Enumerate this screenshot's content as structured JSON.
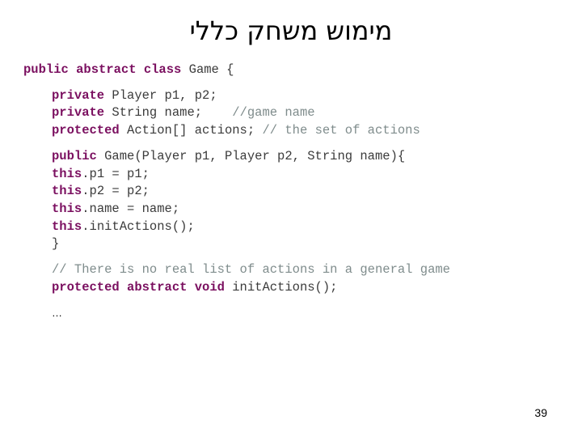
{
  "slide": {
    "title": "מימוש משחק כללי",
    "page_number": "39",
    "accent_keyword_color": "#7B1060",
    "comment_color": "#7F8C8C",
    "code_color": "#3B3B3B",
    "background_color": "#FFFFFF"
  },
  "code": {
    "language": "java",
    "lines": [
      {
        "indent": 0,
        "tokens": [
          {
            "type": "keyword",
            "text": "public abstract class"
          },
          {
            "type": "plain",
            "text": " Game {"
          }
        ]
      },
      {
        "indent": 0,
        "spacer": true,
        "tokens": []
      },
      {
        "indent": 1,
        "tokens": [
          {
            "type": "keyword",
            "text": "private"
          },
          {
            "type": "plain",
            "text": " Player p1, p2;"
          }
        ]
      },
      {
        "indent": 1,
        "tokens": [
          {
            "type": "keyword",
            "text": "private"
          },
          {
            "type": "plain",
            "text": " String name;    "
          },
          {
            "type": "comment",
            "text": "//game name"
          }
        ]
      },
      {
        "indent": 1,
        "tokens": [
          {
            "type": "keyword",
            "text": "protected"
          },
          {
            "type": "plain",
            "text": " Action[] actions; "
          },
          {
            "type": "comment",
            "text": "// the set of actions"
          }
        ]
      },
      {
        "indent": 0,
        "spacer": true,
        "tokens": []
      },
      {
        "indent": 1,
        "tokens": [
          {
            "type": "keyword",
            "text": "public"
          },
          {
            "type": "plain",
            "text": " Game(Player p1, Player p2, String name){"
          }
        ]
      },
      {
        "indent": 1,
        "tokens": [
          {
            "type": "keyword",
            "text": "this"
          },
          {
            "type": "plain",
            "text": ".p1 = p1;"
          }
        ]
      },
      {
        "indent": 1,
        "tokens": [
          {
            "type": "keyword",
            "text": "this"
          },
          {
            "type": "plain",
            "text": ".p2 = p2;"
          }
        ]
      },
      {
        "indent": 1,
        "tokens": [
          {
            "type": "keyword",
            "text": "this"
          },
          {
            "type": "plain",
            "text": ".name = name;"
          }
        ]
      },
      {
        "indent": 1,
        "tokens": [
          {
            "type": "keyword",
            "text": "this"
          },
          {
            "type": "plain",
            "text": ".initActions();"
          }
        ]
      },
      {
        "indent": 1,
        "tokens": [
          {
            "type": "plain",
            "text": "}"
          }
        ]
      },
      {
        "indent": 0,
        "spacer": true,
        "tokens": []
      },
      {
        "indent": 1,
        "tokens": [
          {
            "type": "comment",
            "text": "// There is no real list of actions in a general game"
          }
        ]
      },
      {
        "indent": 1,
        "tokens": [
          {
            "type": "keyword",
            "text": "protected abstract void"
          },
          {
            "type": "plain",
            "text": " initActions();"
          }
        ]
      },
      {
        "indent": 0,
        "spacer": true,
        "tokens": []
      },
      {
        "indent": 1,
        "ellipsis": true,
        "tokens": [
          {
            "type": "ellipsis",
            "text": "…"
          }
        ]
      }
    ]
  }
}
